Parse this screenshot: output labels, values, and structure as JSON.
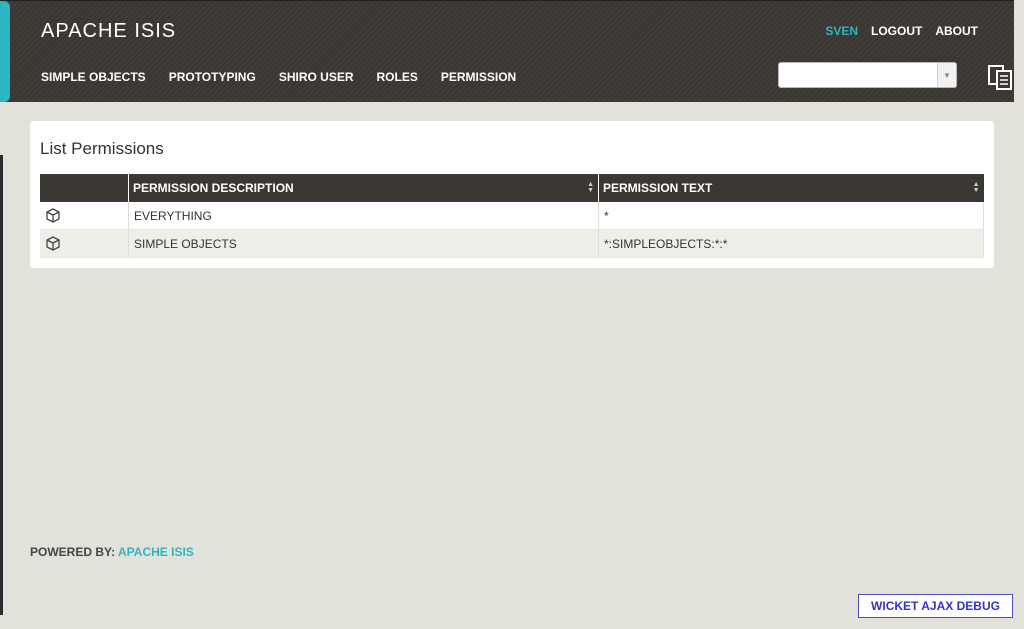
{
  "header": {
    "title": "APACHE ISIS",
    "user_links": {
      "user": "SVEN",
      "logout": "LOGOUT",
      "about": "ABOUT"
    },
    "menu": [
      "SIMPLE OBJECTS",
      "PROTOTYPING",
      "SHIRO USER",
      "ROLES",
      "PERMISSION"
    ],
    "search": {
      "value": ""
    }
  },
  "panel": {
    "title": "List Permissions",
    "columns": [
      "",
      "PERMISSION DESCRIPTION",
      "PERMISSION TEXT"
    ],
    "rows": [
      {
        "icon": "cube-icon",
        "description": "EVERYTHING",
        "text": "*"
      },
      {
        "icon": "cube-icon",
        "description": "SIMPLE OBJECTS",
        "text": "*:SIMPLEOBJECTS:*:*"
      }
    ]
  },
  "footer": {
    "label": "POWERED BY:",
    "link": "APACHE ISIS"
  },
  "debug": {
    "label": "WICKET AJAX DEBUG"
  },
  "colors": {
    "accent": "#2db5c2",
    "header_bg": "#3b3733",
    "page_bg": "#e3e2da",
    "debug_link": "#3333cc"
  }
}
